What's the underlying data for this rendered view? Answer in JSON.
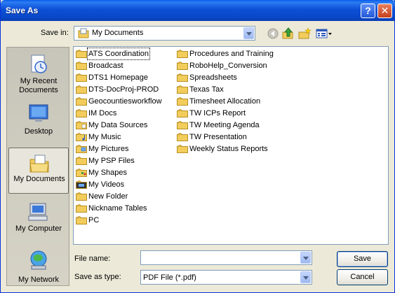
{
  "window": {
    "title": "Save As",
    "help_label": "?",
    "close_label": "✕"
  },
  "toolbar": {
    "save_in_label": "Save in:",
    "save_in_value": "My Documents",
    "icons": [
      "back-icon",
      "up-folder-icon",
      "new-folder-icon",
      "views-menu-icon"
    ]
  },
  "places": [
    {
      "label": "My Recent Documents",
      "icon": "recent-documents-icon"
    },
    {
      "label": "Desktop",
      "icon": "desktop-icon"
    },
    {
      "label": "My Documents",
      "icon": "my-documents-icon",
      "selected": true
    },
    {
      "label": "My Computer",
      "icon": "my-computer-icon"
    },
    {
      "label": "My Network",
      "icon": "my-network-icon"
    }
  ],
  "files": {
    "column1": [
      {
        "name": "ATS Coordination",
        "icon": "folder"
      },
      {
        "name": "Broadcast",
        "icon": "folder"
      },
      {
        "name": "DTS1 Homepage",
        "icon": "folder"
      },
      {
        "name": "DTS-DocProj-PROD",
        "icon": "folder"
      },
      {
        "name": "Geocountiesworkflow",
        "icon": "folder"
      },
      {
        "name": "IM Docs",
        "icon": "folder"
      },
      {
        "name": "My Data Sources",
        "icon": "data-folder"
      },
      {
        "name": "My Music",
        "icon": "music-folder"
      },
      {
        "name": "My Pictures",
        "icon": "pictures-folder"
      },
      {
        "name": "My PSP Files",
        "icon": "folder"
      },
      {
        "name": "My Shapes",
        "icon": "shapes-folder"
      },
      {
        "name": "My Videos",
        "icon": "videos-folder"
      },
      {
        "name": "New Folder",
        "icon": "folder"
      },
      {
        "name": "Nickname Tables",
        "icon": "folder"
      },
      {
        "name": "PC",
        "icon": "folder"
      }
    ],
    "column2": [
      {
        "name": "Procedures and Training",
        "icon": "folder"
      },
      {
        "name": "RoboHelp_Conversion",
        "icon": "folder"
      },
      {
        "name": "Spreadsheets",
        "icon": "folder"
      },
      {
        "name": "Texas Tax",
        "icon": "folder"
      },
      {
        "name": "Timesheet Allocation",
        "icon": "folder"
      },
      {
        "name": "TW ICPs Report",
        "icon": "folder"
      },
      {
        "name": "TW Meeting Agenda",
        "icon": "folder"
      },
      {
        "name": "TW Presentation",
        "icon": "folder"
      },
      {
        "name": "Weekly Status Reports",
        "icon": "folder"
      }
    ]
  },
  "form": {
    "file_name_label": "File name:",
    "file_name_value": "",
    "save_as_type_label": "Save as type:",
    "save_as_type_value": "PDF File (*.pdf)"
  },
  "buttons": {
    "save": "Save",
    "cancel": "Cancel"
  },
  "colors": {
    "title_bar": "#0a48c9",
    "dialog_bg": "#ece9d8",
    "folder": "#f2cd5c"
  }
}
